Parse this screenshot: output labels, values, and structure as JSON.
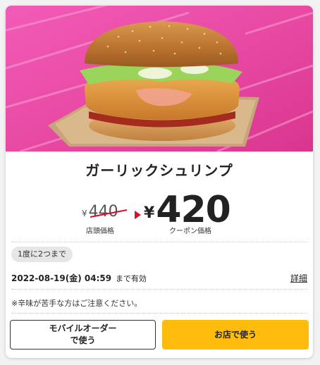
{
  "product": {
    "name": "ガーリックシュリンプ",
    "image": "garlic-shrimp-burger"
  },
  "price": {
    "currency": "¥",
    "regular": "440",
    "regular_label": "店頭価格",
    "coupon": "420",
    "coupon_label": "クーポン価格"
  },
  "limit_badge": "1度に2つまで",
  "expiry": {
    "datetime": "2022-08-19(金) 04:59",
    "suffix": "まで有効"
  },
  "detail_link": "詳細",
  "note": "※辛味が苦手な方はご注意ください。",
  "buttons": {
    "mobile_order": "モバイルオーダー\nで使う",
    "in_store": "お店で使う"
  },
  "colors": {
    "accent_yellow": "#ffbc0d",
    "strike_red": "#d50f25",
    "background_pink": "#e94aa6"
  }
}
